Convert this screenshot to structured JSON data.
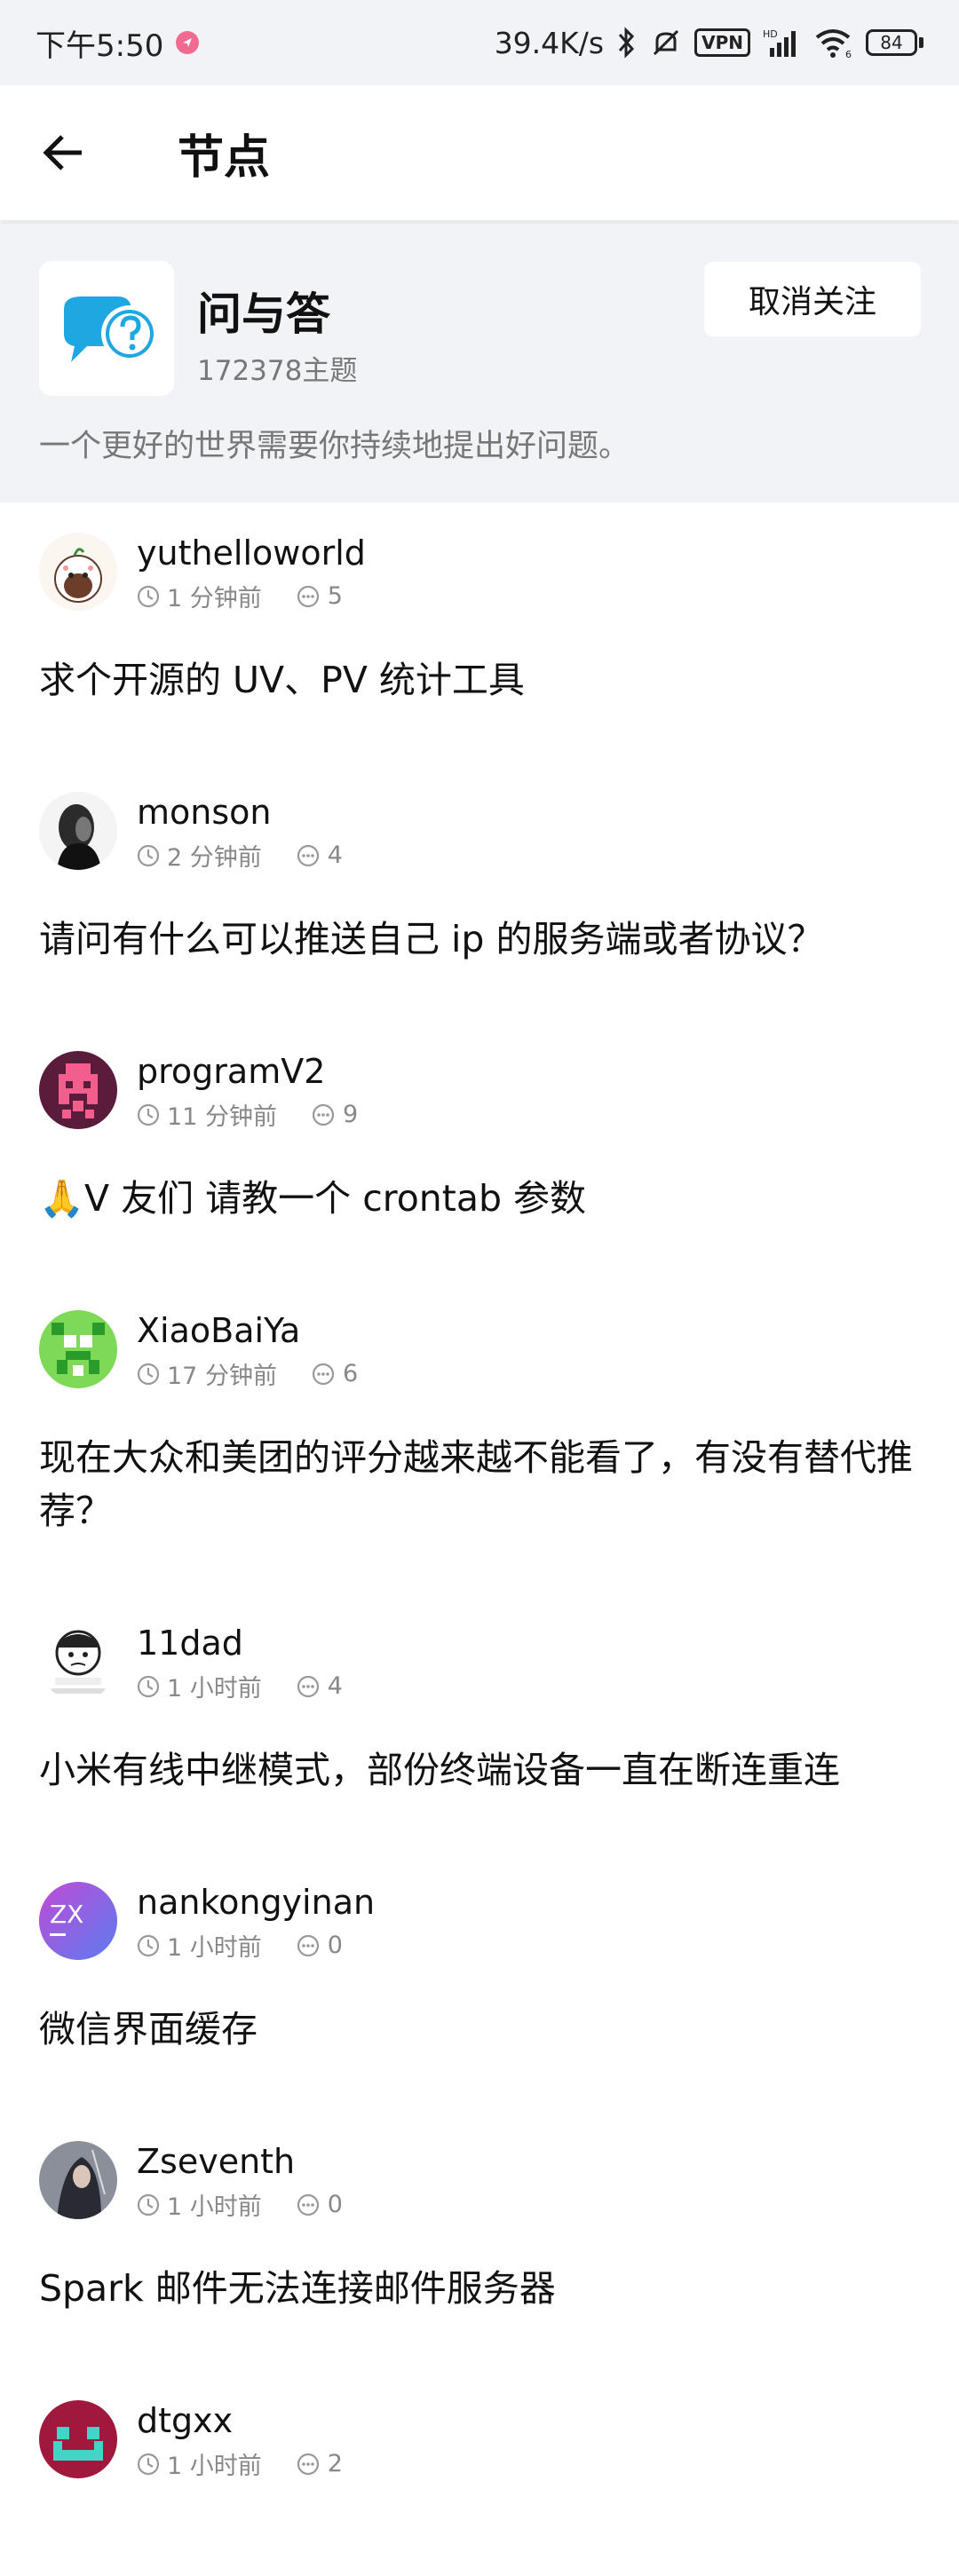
{
  "status_bar": {
    "time": "下午5:50",
    "net_speed": "39.4K/s",
    "vpn": "VPN",
    "signal_label": "HD",
    "wifi_label": "6",
    "battery": "84"
  },
  "appbar": {
    "title": "节点"
  },
  "node": {
    "name": "问与答",
    "topic_count": "172378主题",
    "description": "一个更好的世界需要你持续地提出好问题。",
    "unfollow_label": "取消关注",
    "icon": "question-bubble-icon"
  },
  "colors": {
    "accent": "#1ea7e0",
    "background_panel": "#f2f3f7",
    "muted_text": "#888888"
  },
  "topics": [
    {
      "user": "yuthelloworld",
      "time": "1 分钟前",
      "replies": "5",
      "title": "求个开源的 UV、PV 统计工具"
    },
    {
      "user": "monson",
      "time": "2 分钟前",
      "replies": "4",
      "title": "请问有什么可以推送自己 ip 的服务端或者协议？"
    },
    {
      "user": "programV2",
      "time": "11 分钟前",
      "replies": "9",
      "title": "🙏V 友们 请教一个 crontab 参数"
    },
    {
      "user": "XiaoBaiYa",
      "time": "17 分钟前",
      "replies": "6",
      "title": "现在大众和美团的评分越来越不能看了，有没有替代推荐？"
    },
    {
      "user": "11dad",
      "time": "1 小时前",
      "replies": "4",
      "title": "小米有线中继模式，部份终端设备一直在断连重连"
    },
    {
      "user": "nankongyinan",
      "time": "1 小时前",
      "replies": "0",
      "title": "微信界面缓存"
    },
    {
      "user": "Zseventh",
      "time": "1 小时前",
      "replies": "0",
      "title": "Spark 邮件无法连接邮件服务器"
    },
    {
      "user": "dtgxx",
      "time": "1 小时前",
      "replies": "2",
      "title": ""
    }
  ]
}
